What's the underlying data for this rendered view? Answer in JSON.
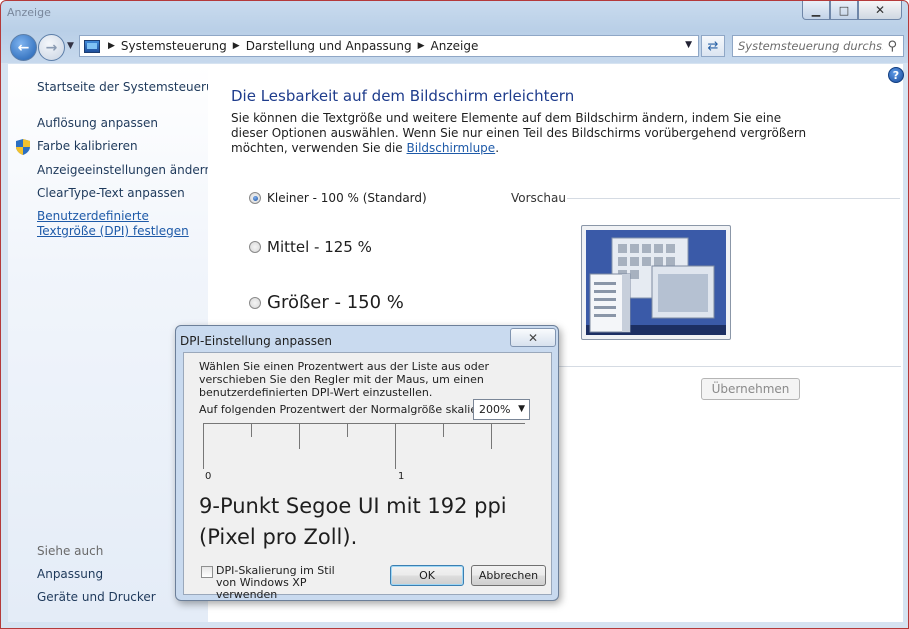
{
  "window": {
    "title": "Anzeige",
    "caption_minimize": "▁",
    "caption_maximize": "□",
    "caption_close": "✕"
  },
  "address_bar": {
    "crumbs": [
      "Systemsteuerung",
      "Darstellung und Anpassung",
      "Anzeige"
    ],
    "search_placeholder": "Systemsteuerung durchs..."
  },
  "left_pane": {
    "home_link": "Startseite der Systemsteuerung",
    "links": [
      "Auflösung anpassen",
      "Farbe kalibrieren",
      "Anzeigeeinstellungen ändern",
      "ClearType-Text anpassen",
      "Benutzerdefinierte Textgröße (DPI) festlegen"
    ],
    "see_also_heading": "Siehe auch",
    "see_also_links": [
      "Anpassung",
      "Geräte und Drucker"
    ]
  },
  "main": {
    "title": "Die Lesbarkeit auf dem Bildschirm erleichtern",
    "description": "Sie können die Textgröße und weitere Elemente auf dem Bildschirm ändern, indem Sie eine dieser Optionen auswählen. Wenn Sie nur einen Teil des Bildschirms vorübergehend vergrößern möchten, verwenden Sie die",
    "magnifier_link": "Bildschirmlupe",
    "description_end": ".",
    "options": [
      {
        "label": "Kleiner - 100 % (Standard)",
        "checked": true
      },
      {
        "label": "Mittel - 125 %",
        "checked": false
      },
      {
        "label": "Größer - 150 %",
        "checked": false
      }
    ],
    "preview_label": "Vorschau",
    "apply_button": "Übernehmen"
  },
  "dialog": {
    "title": "DPI-Einstellung anpassen",
    "close": "✕",
    "description": "Wählen Sie einen Prozentwert aus der Liste aus oder verschieben Sie den Regler mit der Maus, um einen benutzerdefinierten DPI-Wert einzustellen.",
    "scale_label": "Auf folgenden Prozentwert der Normalgröße skalieren:",
    "scale_value": "200%",
    "ruler_labels": [
      "0",
      "1"
    ],
    "sample_text": "9-Punkt Segoe UI mit 192 ppi (Pixel pro Zoll).",
    "xp_checkbox_label": "DPI-Skalierung im Stil von Windows XP verwenden",
    "xp_checkbox_checked": false,
    "ok_button": "OK",
    "cancel_button": "Abbrechen"
  },
  "icons": {
    "back": "back-arrow-icon",
    "forward": "forward-arrow-icon",
    "refresh": "refresh-icon",
    "search": "search-icon",
    "help": "help-icon",
    "shield": "uac-shield-icon"
  }
}
